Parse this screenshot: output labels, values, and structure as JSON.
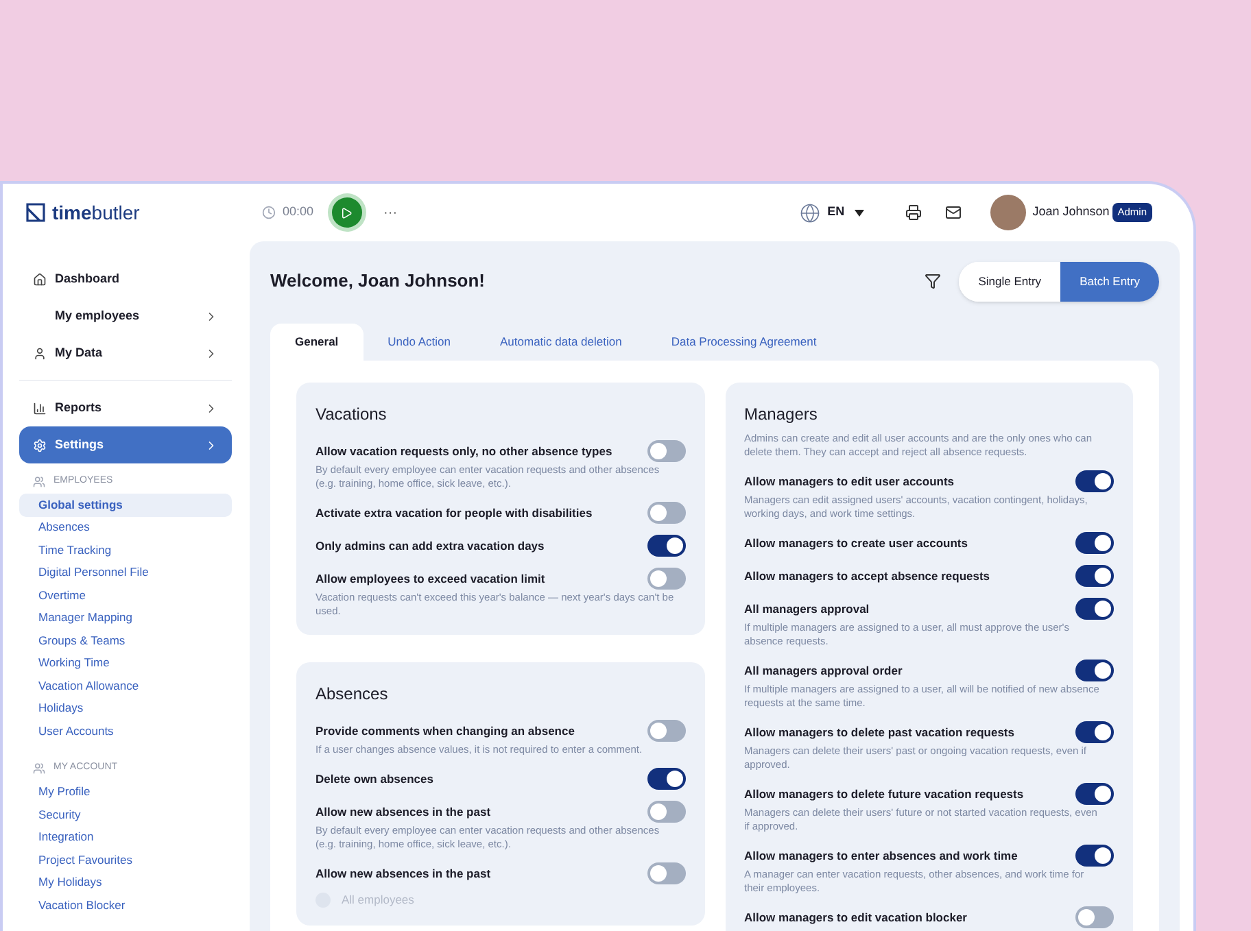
{
  "header": {
    "logo_bold": "time",
    "logo_light": "butler",
    "timer": "00:00",
    "more": "···",
    "language": "EN",
    "user_name": "Joan Johnson",
    "user_role": "Admin"
  },
  "sidebar": {
    "nav_groups": [
      [
        {
          "label": "Dashboard",
          "expandable": false,
          "selected": false
        },
        {
          "label": "My employees",
          "expandable": true,
          "selected": false
        },
        {
          "label": "My Data",
          "expandable": true,
          "selected": false
        }
      ],
      [
        {
          "label": "Reports",
          "expandable": true,
          "selected": false
        },
        {
          "label": "Settings",
          "expandable": true,
          "selected": true
        }
      ]
    ],
    "sections": [
      {
        "title": "EMPLOYEES",
        "items": [
          {
            "label": "Global settings",
            "selected": true
          },
          {
            "label": "Absences",
            "selected": false
          },
          {
            "label": "Time Tracking",
            "selected": false
          },
          {
            "label": "Digital Personnel File",
            "selected": false
          },
          {
            "label": "Overtime",
            "selected": false
          },
          {
            "label": "Manager Mapping",
            "selected": false
          },
          {
            "label": "Groups & Teams",
            "selected": false
          },
          {
            "label": "Working Time",
            "selected": false
          },
          {
            "label": "Vacation Allowance",
            "selected": false
          },
          {
            "label": "Holidays",
            "selected": false
          },
          {
            "label": "User Accounts",
            "selected": false
          }
        ]
      },
      {
        "title": "MY ACCOUNT",
        "items": [
          {
            "label": "My Profile",
            "selected": false
          },
          {
            "label": "Security",
            "selected": false
          },
          {
            "label": "Integration",
            "selected": false
          },
          {
            "label": "Project Favourites",
            "selected": false
          },
          {
            "label": "My Holidays",
            "selected": false
          },
          {
            "label": "Vacation Blocker",
            "selected": false
          }
        ]
      }
    ]
  },
  "main": {
    "title": "Welcome, Joan Johnson!",
    "entry_modes": [
      {
        "label": "Single Entry",
        "selected": false
      },
      {
        "label": "Batch Entry",
        "selected": true
      }
    ],
    "tabs": [
      {
        "label": "General",
        "selected": true
      },
      {
        "label": "Undo Action",
        "selected": false
      },
      {
        "label": "Automatic data deletion",
        "selected": false
      },
      {
        "label": "Data Processing Agreement",
        "selected": false
      }
    ],
    "columns": [
      [
        {
          "title": "Vacations",
          "items": [
            {
              "kind": "toggle",
              "label": "Allow vacation requests only, no other absence types",
              "on": false,
              "description": "By default every employee can enter vacation requests and other absences (e.g. training, home office, sick leave, etc.)."
            },
            {
              "kind": "toggle",
              "label": "Activate extra vacation for people with disabilities",
              "on": false
            },
            {
              "kind": "toggle",
              "label": "Only admins can add extra vacation days",
              "on": true
            },
            {
              "kind": "toggle",
              "label": "Allow employees to exceed vacation limit",
              "on": false,
              "description": "Vacation requests can't exceed this year's balance — next year's days can't be used."
            }
          ]
        },
        {
          "title": "Absences",
          "items": [
            {
              "kind": "toggle",
              "label": "Provide comments when changing an absence",
              "on": false,
              "description": "If a user changes absence values, it is not required to enter a comment."
            },
            {
              "kind": "toggle",
              "label": "Delete own absences",
              "on": true
            },
            {
              "kind": "toggle",
              "label": "Allow new absences in the past",
              "on": false,
              "description": "By default every employee can enter vacation requests and other absences (e.g. training, home office, sick leave, etc.)."
            },
            {
              "kind": "toggle",
              "label": "Allow new absences in the past",
              "on": false
            },
            {
              "kind": "radio",
              "label": "All employees",
              "selected": false
            }
          ]
        }
      ],
      [
        {
          "title": "Managers",
          "description": "Admins can create and edit all user accounts and are the only ones who can delete them. They can accept and reject all absence requests.",
          "items": [
            {
              "kind": "toggle",
              "label": "Allow managers to edit user accounts",
              "on": true,
              "description": "Managers can edit assigned users' accounts, vacation contingent, holidays, working days, and work time settings."
            },
            {
              "kind": "toggle",
              "label": "Allow managers to create user accounts",
              "on": true
            },
            {
              "kind": "toggle",
              "label": "Allow managers to accept absence requests",
              "on": true
            },
            {
              "kind": "toggle",
              "label": "All managers approval",
              "on": true,
              "description": "If multiple managers are assigned to a user, all must approve the user's absence requests."
            },
            {
              "kind": "toggle",
              "label": "All managers approval order",
              "on": true,
              "description": "If multiple managers are assigned to a user, all will be notified of new absence requests at the same time."
            },
            {
              "kind": "toggle",
              "label": "Allow managers to delete past vacation requests",
              "on": true,
              "description": "Managers can delete their users' past or ongoing vacation requests, even if approved."
            },
            {
              "kind": "toggle",
              "label": "Allow managers to delete future vacation requests",
              "on": true,
              "description": "Managers can delete their users' future or not started vacation requests, even if approved."
            },
            {
              "kind": "toggle",
              "label": "Allow managers to enter absences and work time",
              "on": true,
              "description": "A manager can enter vacation requests, other absences, and work time for their employees."
            },
            {
              "kind": "toggle",
              "label": "Allow managers to edit vacation blocker",
              "on": false
            }
          ]
        }
      ]
    ]
  }
}
